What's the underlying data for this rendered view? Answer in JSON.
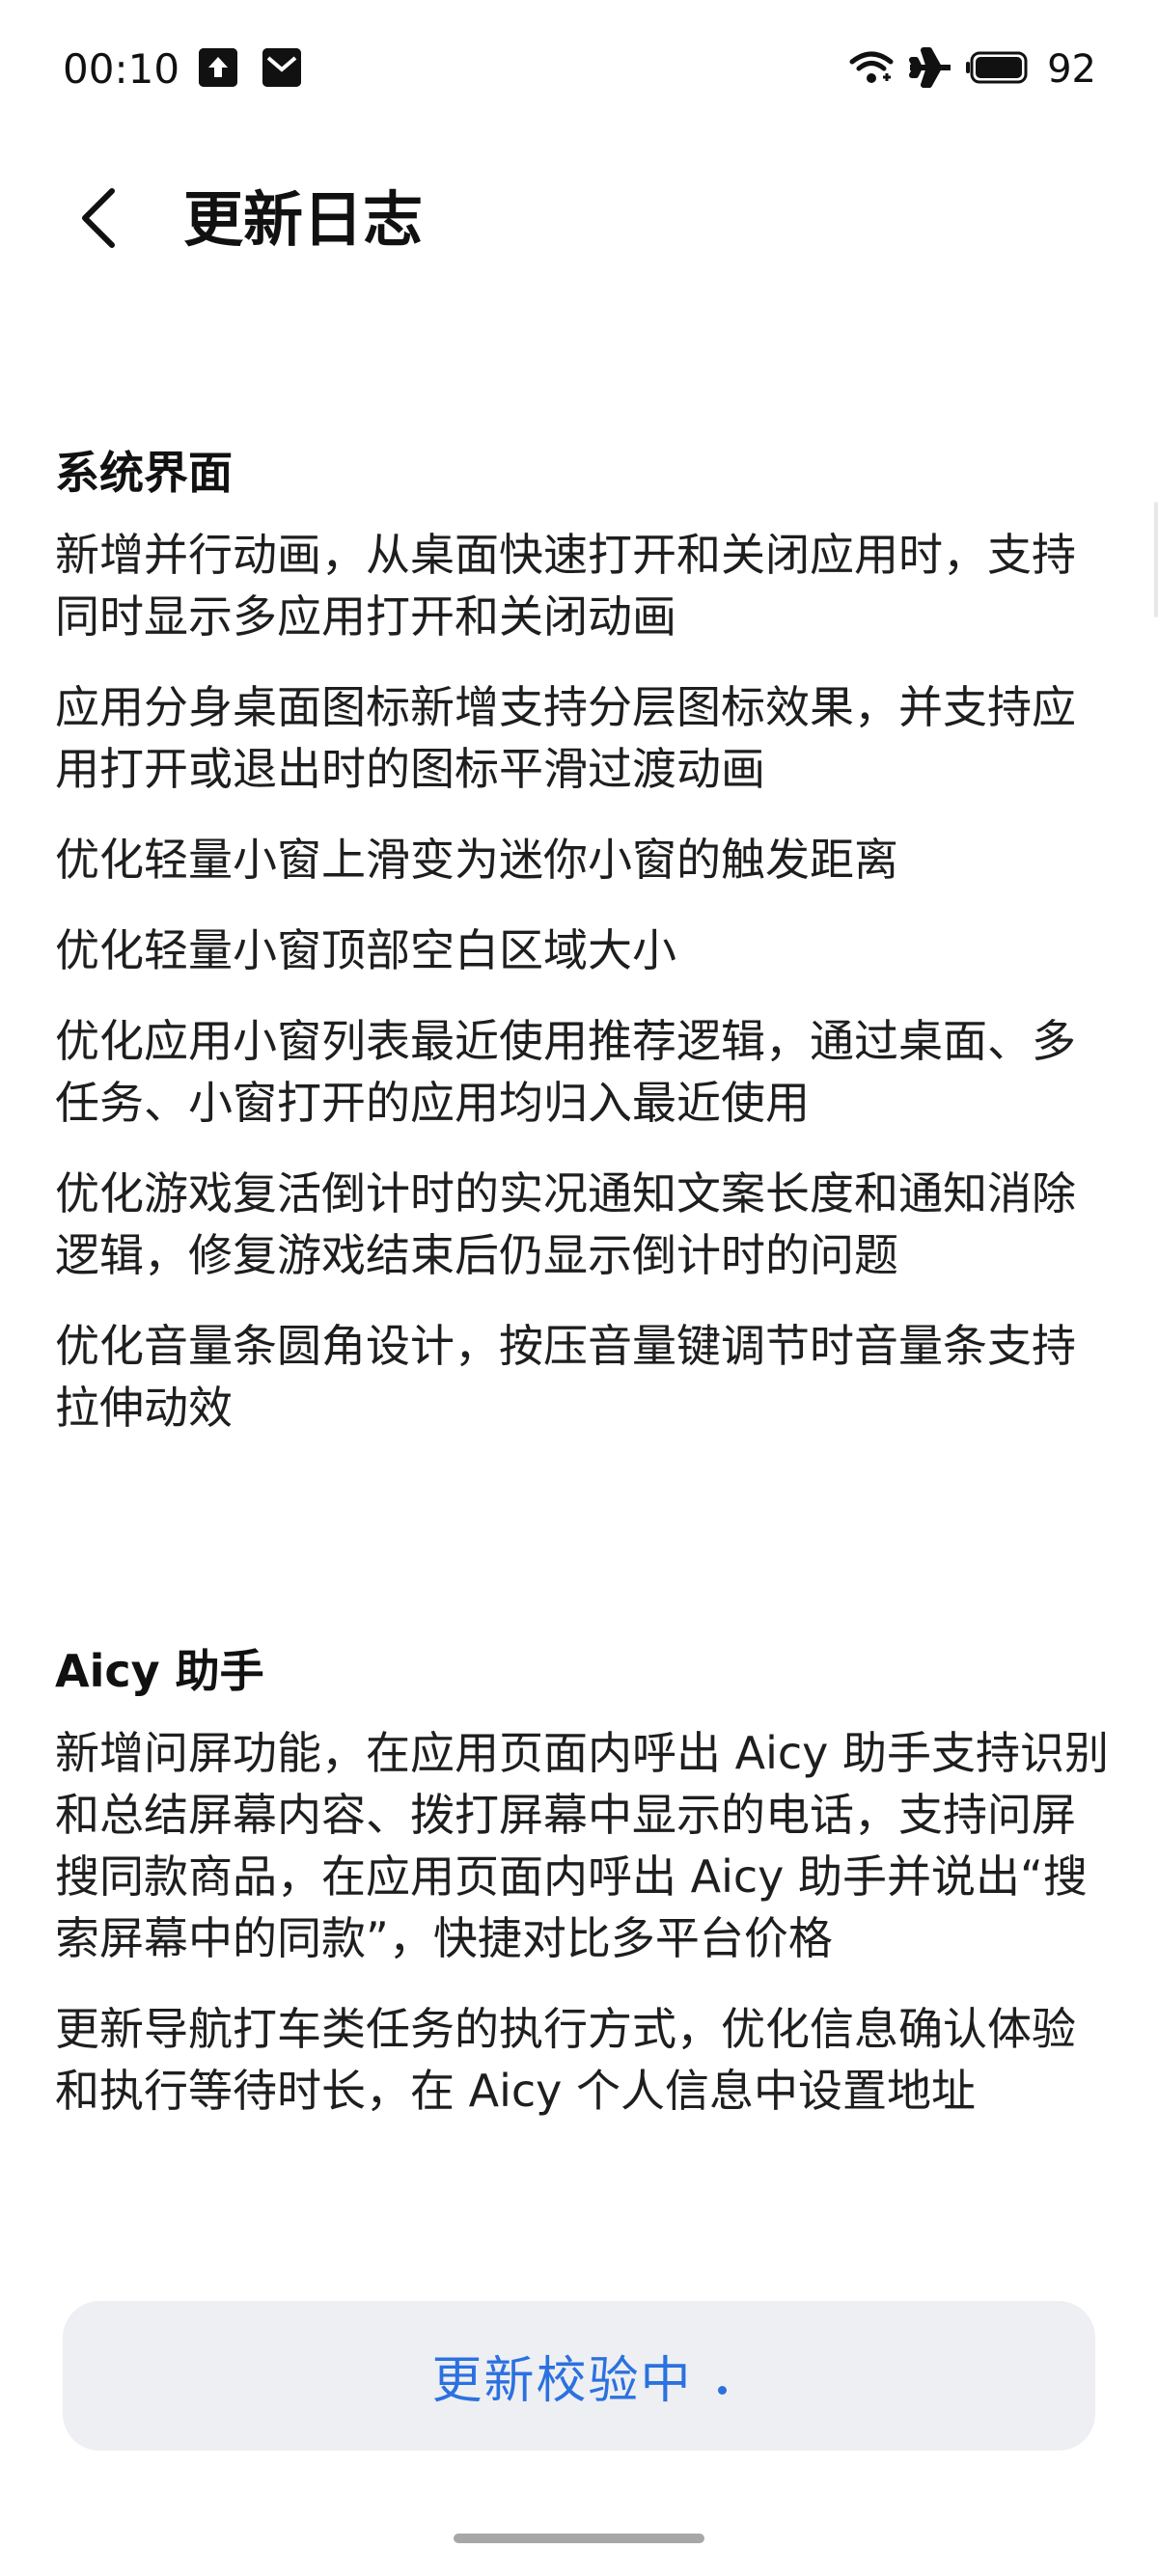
{
  "status_bar": {
    "time": "00:10",
    "battery": "92",
    "icons": [
      "upload-icon",
      "mail-icon",
      "wifi-icon",
      "airplane-icon",
      "battery-icon"
    ]
  },
  "header": {
    "title": "更新日志",
    "back_icon": "back-arrow-icon"
  },
  "sections": [
    {
      "title": "系统界面",
      "items": [
        "新增并行动画，从桌面快速打开和关闭应用时，支持同时显示多应用打开和关闭动画",
        "应用分身桌面图标新增支持分层图标效果，并支持应用打开或退出时的图标平滑过渡动画",
        "优化轻量小窗上滑变为迷你小窗的触发距离",
        "优化轻量小窗顶部空白区域大小",
        "优化应用小窗列表最近使用推荐逻辑，通过桌面、多任务、小窗打开的应用均归入最近使用",
        "优化游戏复活倒计时的实况通知文案长度和通知消除逻辑，修复游戏结束后仍显示倒计时的问题",
        "优化音量条圆角设计，按压音量键调节时音量条支持拉伸动效"
      ]
    },
    {
      "title": "Aicy 助手",
      "items": [
        "新增问屏功能，在应用页面内呼出 Aicy 助手支持识别和总结屏幕内容、拨打屏幕中显示的电话，支持问屏搜同款商品，在应用页面内呼出 Aicy 助手并说出“搜索屏幕中的同款”，快捷对比多平台价格",
        "更新导航打车类任务的执行方式，优化信息确认体验和执行等待时长，在 Aicy 个人信息中设置地址"
      ]
    }
  ],
  "footer": {
    "button_label": "更新校验中"
  },
  "colors": {
    "accent": "#2b71e0",
    "button_bg": "#eeeff2",
    "text": "#1e1e1e"
  }
}
